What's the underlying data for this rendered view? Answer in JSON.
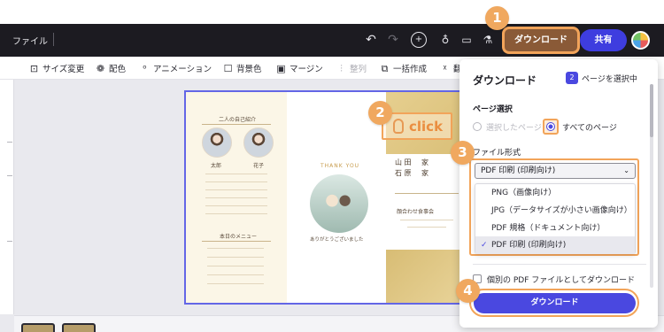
{
  "topbar": {
    "file_menu": "ファイル",
    "download_label": "ダウンロード",
    "share_label": "共有",
    "icons": [
      "undo-icon",
      "redo-icon",
      "add-user-icon",
      "lightbulb-icon",
      "comment-icon",
      "flask-icon"
    ]
  },
  "toolbar": {
    "items": [
      {
        "label": "サイズ変更",
        "icon": "resize-icon"
      },
      {
        "label": "配色",
        "icon": "palette-icon"
      },
      {
        "label": "アニメーション",
        "icon": "animation-icon"
      },
      {
        "label": "背景色",
        "icon": "square-icon"
      },
      {
        "label": "マージン",
        "icon": "margin-icon"
      },
      {
        "label": "整列",
        "icon": "align-icon"
      },
      {
        "label": "一括作成",
        "icon": "bulk-icon"
      },
      {
        "label": "翻",
        "icon": "translate-icon"
      }
    ]
  },
  "steps": {
    "s1": "1",
    "s2": "2",
    "s3": "3",
    "s4": "4"
  },
  "click_marker": "click",
  "canvas": {
    "heading": "二人の自己紹介",
    "groom_name": "太郎",
    "bride_name": "花子",
    "menu_heading": "本日のメニュー",
    "thank_you": "THANK YOU",
    "thanks_msg": "ありがとうございました",
    "family_1": "山 田",
    "family_2": "石 原",
    "family_label_1": "家",
    "family_label_2": "家",
    "event_title": "顔合わせ食事会"
  },
  "download_panel": {
    "title": "ダウンロード",
    "page_count": "2",
    "page_select_label": "ページを選択中",
    "page_section": "ページ選択",
    "radio_selected_pages": "選択したページ",
    "radio_all_pages": "すべてのページ",
    "format_section": "ファイル形式",
    "format_value": "PDF 印刷 (印刷向け)",
    "options": [
      "PNG（画像向け）",
      "JPG（データサイズが小さい画像向け）",
      "PDF 規格（ドキュメント向け）",
      "PDF 印刷 (印刷向け)"
    ],
    "separate_pdf_label": "個別の PDF ファイルとしてダウンロード",
    "download_button": "ダウンロード",
    "accent_color": "#4a48e0",
    "highlight_color": "#f2a45a"
  }
}
